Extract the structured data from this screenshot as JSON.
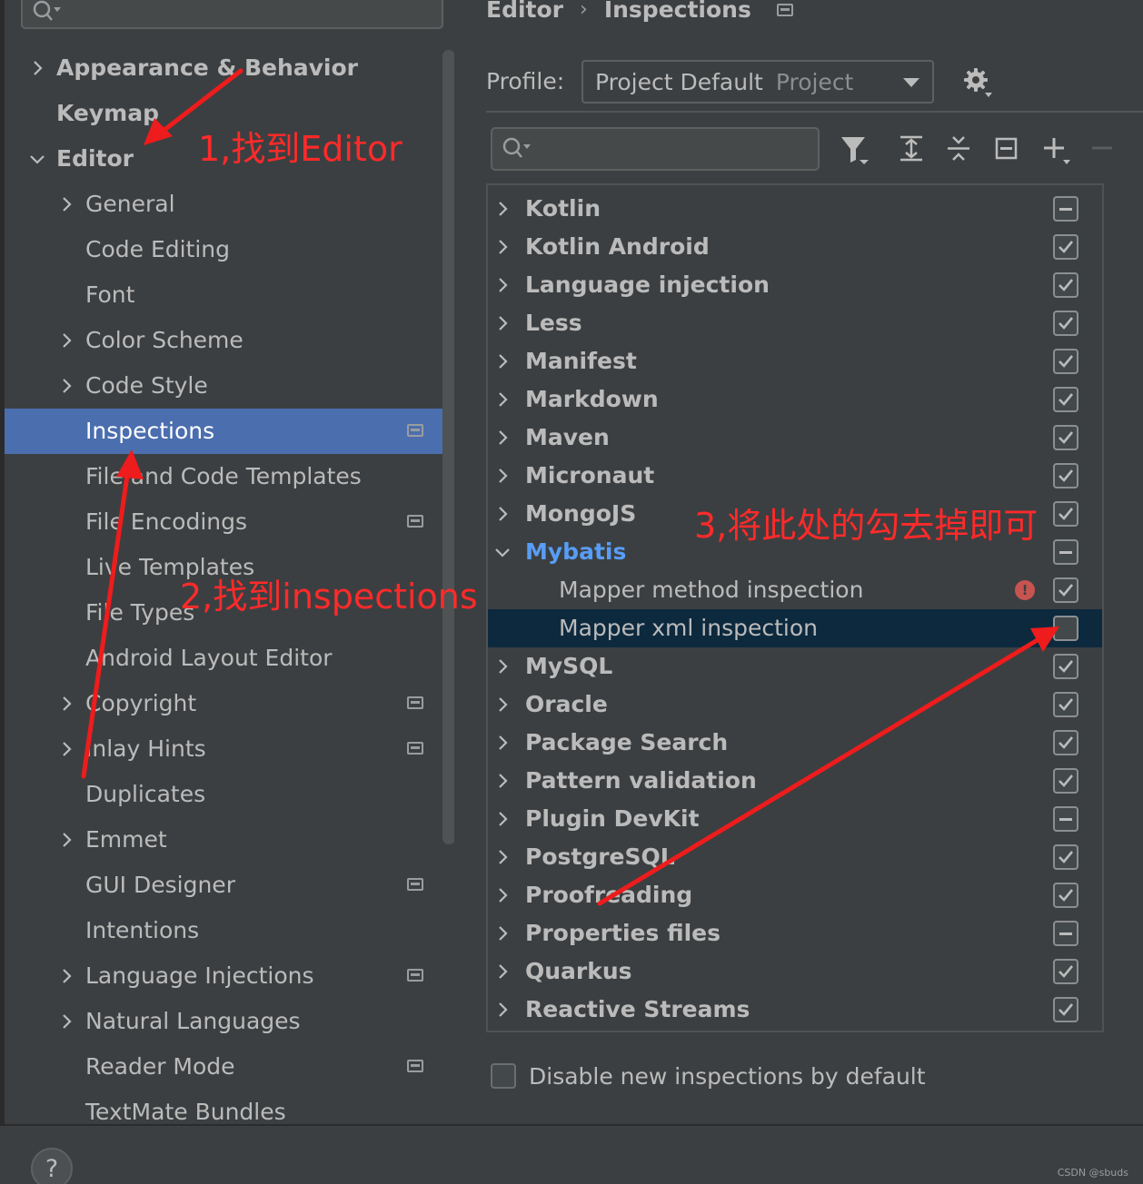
{
  "sidebar": {
    "search_placeholder": "",
    "items": [
      {
        "label": "Appearance & Behavior",
        "chevron": "right",
        "bold": true,
        "level": 0
      },
      {
        "label": "Keymap",
        "chevron": "",
        "bold": true,
        "level": 0
      },
      {
        "label": "Editor",
        "chevron": "down",
        "bold": true,
        "level": 0
      },
      {
        "label": "General",
        "chevron": "right",
        "level": 1
      },
      {
        "label": "Code Editing",
        "chevron": "",
        "level": 1
      },
      {
        "label": "Font",
        "chevron": "",
        "level": 1
      },
      {
        "label": "Color Scheme",
        "chevron": "right",
        "level": 1
      },
      {
        "label": "Code Style",
        "chevron": "right",
        "level": 1
      },
      {
        "label": "Inspections",
        "chevron": "",
        "level": 1,
        "selected": true,
        "project_icon": true
      },
      {
        "label": "File and Code Templates",
        "chevron": "",
        "level": 1
      },
      {
        "label": "File Encodings",
        "chevron": "",
        "level": 1,
        "project_icon": true
      },
      {
        "label": "Live Templates",
        "chevron": "",
        "level": 1
      },
      {
        "label": "File Types",
        "chevron": "",
        "level": 1
      },
      {
        "label": "Android Layout Editor",
        "chevron": "",
        "level": 1
      },
      {
        "label": "Copyright",
        "chevron": "right",
        "level": 1,
        "project_icon": true
      },
      {
        "label": "Inlay Hints",
        "chevron": "right",
        "level": 1,
        "project_icon": true
      },
      {
        "label": "Duplicates",
        "chevron": "",
        "level": 1
      },
      {
        "label": "Emmet",
        "chevron": "right",
        "level": 1
      },
      {
        "label": "GUI Designer",
        "chevron": "",
        "level": 1,
        "project_icon": true
      },
      {
        "label": "Intentions",
        "chevron": "",
        "level": 1
      },
      {
        "label": "Language Injections",
        "chevron": "right",
        "level": 1,
        "project_icon": true
      },
      {
        "label": "Natural Languages",
        "chevron": "right",
        "level": 1
      },
      {
        "label": "Reader Mode",
        "chevron": "",
        "level": 1,
        "project_icon": true
      },
      {
        "label": "TextMate Bundles",
        "chevron": "",
        "level": 1
      }
    ]
  },
  "breadcrumb": {
    "parent": "Editor",
    "separator": "›",
    "current": "Inspections"
  },
  "profile": {
    "label": "Profile:",
    "name": "Project Default",
    "scope": "Project"
  },
  "inspections": {
    "search_placeholder": "",
    "rows": [
      {
        "label": "Kotlin",
        "chevron": "right",
        "state": "indeterminate",
        "bold": true
      },
      {
        "label": "Kotlin Android",
        "chevron": "right",
        "state": "checked",
        "bold": true
      },
      {
        "label": "Language injection",
        "chevron": "right",
        "state": "checked",
        "bold": true
      },
      {
        "label": "Less",
        "chevron": "right",
        "state": "checked",
        "bold": true
      },
      {
        "label": "Manifest",
        "chevron": "right",
        "state": "checked",
        "bold": true
      },
      {
        "label": "Markdown",
        "chevron": "right",
        "state": "checked",
        "bold": true
      },
      {
        "label": "Maven",
        "chevron": "right",
        "state": "checked",
        "bold": true
      },
      {
        "label": "Micronaut",
        "chevron": "right",
        "state": "checked",
        "bold": true
      },
      {
        "label": "MongoJS",
        "chevron": "right",
        "state": "checked",
        "bold": true
      },
      {
        "label": "Mybatis",
        "chevron": "down",
        "state": "indeterminate",
        "bold": true,
        "highlight": true
      },
      {
        "label": "Mapper method inspection",
        "chevron": "",
        "state": "checked",
        "child": true,
        "severity_icon": "error"
      },
      {
        "label": "Mapper xml inspection",
        "chevron": "",
        "state": "unchecked",
        "child": true,
        "selected": true
      },
      {
        "label": "MySQL",
        "chevron": "right",
        "state": "checked",
        "bold": true
      },
      {
        "label": "Oracle",
        "chevron": "right",
        "state": "checked",
        "bold": true
      },
      {
        "label": "Package Search",
        "chevron": "right",
        "state": "checked",
        "bold": true
      },
      {
        "label": "Pattern validation",
        "chevron": "right",
        "state": "checked",
        "bold": true
      },
      {
        "label": "Plugin DevKit",
        "chevron": "right",
        "state": "indeterminate",
        "bold": true
      },
      {
        "label": "PostgreSQL",
        "chevron": "right",
        "state": "checked",
        "bold": true
      },
      {
        "label": "Proofreading",
        "chevron": "right",
        "state": "checked",
        "bold": true
      },
      {
        "label": "Properties files",
        "chevron": "right",
        "state": "indeterminate",
        "bold": true
      },
      {
        "label": "Quarkus",
        "chevron": "right",
        "state": "checked",
        "bold": true
      },
      {
        "label": "Reactive Streams",
        "chevron": "right",
        "state": "checked",
        "bold": true
      }
    ]
  },
  "disable_new": {
    "label": "Disable new inspections by default",
    "checked": false
  },
  "help": {
    "label": "?"
  },
  "watermark": "CSDN @sbuds",
  "annotations": {
    "step1": "1,找到Editor",
    "step2": "2,找到inspections",
    "step3": "3,将此处的勾去掉即可"
  },
  "colors": {
    "background": "#3c3f41",
    "selection": "#4b6eaf",
    "tree_selection": "#0d293e",
    "link_blue": "#589df6",
    "annotation_red": "#ff2a2a"
  }
}
